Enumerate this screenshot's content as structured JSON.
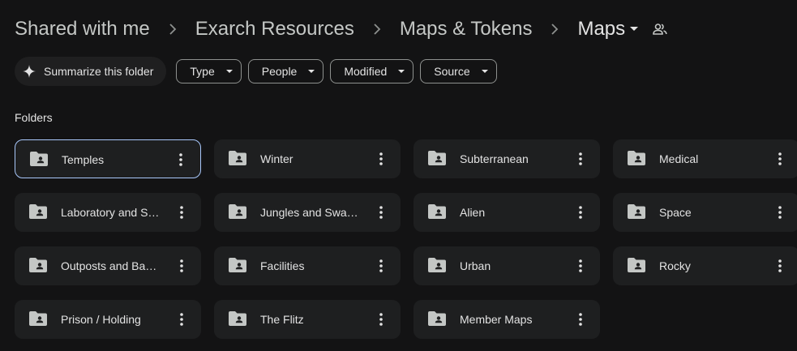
{
  "breadcrumb": {
    "items": [
      "Shared with me",
      "Exarch Resources",
      "Maps & Tokens"
    ],
    "current": "Maps",
    "separator_icon": "chevron-right-icon",
    "caret_icon": "caret-down-icon",
    "shared_icon": "people-icon"
  },
  "filters": {
    "summarize_label": "Summarize this folder",
    "summarize_icon": "sparkle-icon",
    "chips": [
      "Type",
      "People",
      "Modified",
      "Source"
    ]
  },
  "section": {
    "heading": "Folders"
  },
  "folders": [
    {
      "name": "Temples",
      "selected": true
    },
    {
      "name": "Winter"
    },
    {
      "name": "Subterranean"
    },
    {
      "name": "Medical"
    },
    {
      "name": "Laboratory and S…"
    },
    {
      "name": "Jungles and Swa…"
    },
    {
      "name": "Alien"
    },
    {
      "name": "Space"
    },
    {
      "name": "Outposts and Ba…"
    },
    {
      "name": "Facilities"
    },
    {
      "name": "Urban"
    },
    {
      "name": "Rocky"
    },
    {
      "name": "Prison / Holding"
    },
    {
      "name": "The Flitz"
    },
    {
      "name": "Member Maps"
    }
  ],
  "colors": {
    "background": "#131314",
    "card": "#1e1f20",
    "selected_border": "#a8c7fa",
    "text": "#e3e3e3"
  }
}
